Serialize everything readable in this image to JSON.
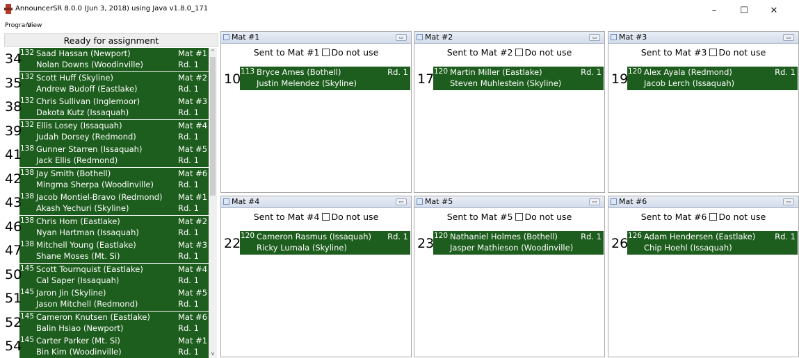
{
  "window": {
    "title": "AnnouncerSR 8.0.0 (Jun 3, 2018) using Java v1.8.0_171",
    "minimize": "–",
    "maximize": "☐",
    "close": "✕"
  },
  "menu": {
    "program": "Program",
    "view": "View"
  },
  "queue": {
    "header": "Ready for assignment",
    "rows": [
      {
        "num": "34",
        "weight": "132",
        "top": "Saad Hassan (Newport)",
        "bottom": "Nolan Downs (Woodinville)",
        "mat": "Mat #1",
        "round": "Rd. 1"
      },
      {
        "num": "35",
        "weight": "132",
        "top": "Scott Huff (Skyline)",
        "bottom": "Andrew Budoff (Eastlake)",
        "mat": "Mat #2",
        "round": "Rd. 1"
      },
      {
        "num": "38",
        "weight": "132",
        "top": "Chris Sullivan (Inglemoor)",
        "bottom": "Dakota Kutz (Issaquah)",
        "mat": "Mat #3",
        "round": "Rd. 1"
      },
      {
        "num": "39",
        "weight": "132",
        "top": "Ellis Losey (Issaquah)",
        "bottom": "Judah Dorsey (Redmond)",
        "mat": "Mat #4",
        "round": "Rd. 1"
      },
      {
        "num": "41",
        "weight": "138",
        "top": "Gunner Starren (Issaquah)",
        "bottom": "Jack Ellis (Redmond)",
        "mat": "Mat #5",
        "round": "Rd. 1"
      },
      {
        "num": "42",
        "weight": "138",
        "top": "Jay Smith (Bothell)",
        "bottom": "Mingma Sherpa (Woodinville)",
        "mat": "Mat #6",
        "round": "Rd. 1"
      },
      {
        "num": "43",
        "weight": "138",
        "top": "Jacob Montiel-Bravo (Redmond)",
        "bottom": "Akash Yechuri (Skyline)",
        "mat": "Mat #1",
        "round": "Rd. 1"
      },
      {
        "num": "46",
        "weight": "138",
        "top": "Chris Hom (Eastlake)",
        "bottom": "Nyan Hartman (Issaquah)",
        "mat": "Mat #2",
        "round": "Rd. 1"
      },
      {
        "num": "47",
        "weight": "138",
        "top": "Mitchell Young (Eastlake)",
        "bottom": "Shane Moses (Mt. Si)",
        "mat": "Mat #3",
        "round": "Rd. 1"
      },
      {
        "num": "50",
        "weight": "145",
        "top": "Scott Tournquist (Eastlake)",
        "bottom": "Cal Saper (Issaquah)",
        "mat": "Mat #4",
        "round": "Rd. 1"
      },
      {
        "num": "51",
        "weight": "145",
        "top": "Jaron Jin (Skyline)",
        "bottom": "Jason Mitchell (Redmond)",
        "mat": "Mat #5",
        "round": "Rd. 1"
      },
      {
        "num": "52",
        "weight": "145",
        "top": "Cameron Knutsen (Eastlake)",
        "bottom": "Balin Hsiao (Newport)",
        "mat": "Mat #6",
        "round": "Rd. 1"
      },
      {
        "num": "54",
        "weight": "145",
        "top": "Carter Parker (Mt. Si)",
        "bottom": "Bin Kim (Woodinville)",
        "mat": "Mat #1",
        "round": "Rd. 1"
      }
    ],
    "scroll_up": "^",
    "scroll_down": "v"
  },
  "mats": [
    {
      "title": "Mat #1",
      "status": "Sent to Mat #1",
      "do_not_use": "Do not use",
      "bout": {
        "num": "10",
        "weight": "113",
        "top": "Bryce Ames (Bothell)",
        "bottom": "Justin Melendez (Skyline)",
        "round": "Rd. 1"
      }
    },
    {
      "title": "Mat #2",
      "status": "Sent to Mat #2",
      "do_not_use": "Do not use",
      "bout": {
        "num": "17",
        "weight": "120",
        "top": "Martin Miller (Eastlake)",
        "bottom": "Steven Muhlestein (Skyline)",
        "round": "Rd. 1"
      }
    },
    {
      "title": "Mat #3",
      "status": "Sent to Mat #3",
      "do_not_use": "Do not use",
      "bout": {
        "num": "19",
        "weight": "120",
        "top": "Alex Ayala (Redmond)",
        "bottom": "Jacob Lerch (Issaquah)",
        "round": "Rd. 1"
      }
    },
    {
      "title": "Mat #4",
      "status": "Sent to Mat #4",
      "do_not_use": "Do not use",
      "bout": {
        "num": "22",
        "weight": "120",
        "top": "Cameron Rasmus (Issaquah)",
        "bottom": "Ricky Lumala (Skyline)",
        "round": "Rd. 1"
      }
    },
    {
      "title": "Mat #5",
      "status": "Sent to Mat #5",
      "do_not_use": "Do not use",
      "bout": {
        "num": "23",
        "weight": "120",
        "top": "Nathaniel Holmes (Bothell)",
        "bottom": "Jasper Mathieson (Woodinville)",
        "round": "Rd. 1"
      }
    },
    {
      "title": "Mat #6",
      "status": "Sent to Mat #6",
      "do_not_use": "Do not use",
      "bout": {
        "num": "26",
        "weight": "126",
        "top": "Adam Hendersen (Eastlake)",
        "bottom": "Chip Hoehl (Issaquah)",
        "round": "Rd. 1"
      }
    }
  ],
  "colors": {
    "bout_bg": "#1d5d1d",
    "title_gradient_top": "#e9eef6"
  }
}
